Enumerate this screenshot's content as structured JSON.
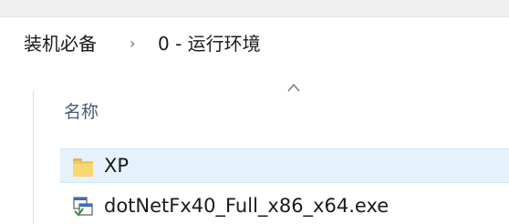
{
  "address_bar": {
    "crumbs": [
      "装机必备",
      "0 - 运行环境"
    ],
    "separator": "›"
  },
  "file_list": {
    "columns": [
      {
        "label": "名称",
        "sort": "ascending"
      }
    ],
    "items": [
      {
        "name": "XP",
        "type": "folder",
        "icon": "folder-icon",
        "selected": true
      },
      {
        "name": "dotNetFx40_Full_x86_x64.exe",
        "type": "application",
        "icon": "installer-exe-icon",
        "selected": false
      }
    ]
  },
  "colors": {
    "selection_bg": "#e5f1fb",
    "selection_border": "#cce8ff",
    "folder_yellow": "#f8d775"
  }
}
